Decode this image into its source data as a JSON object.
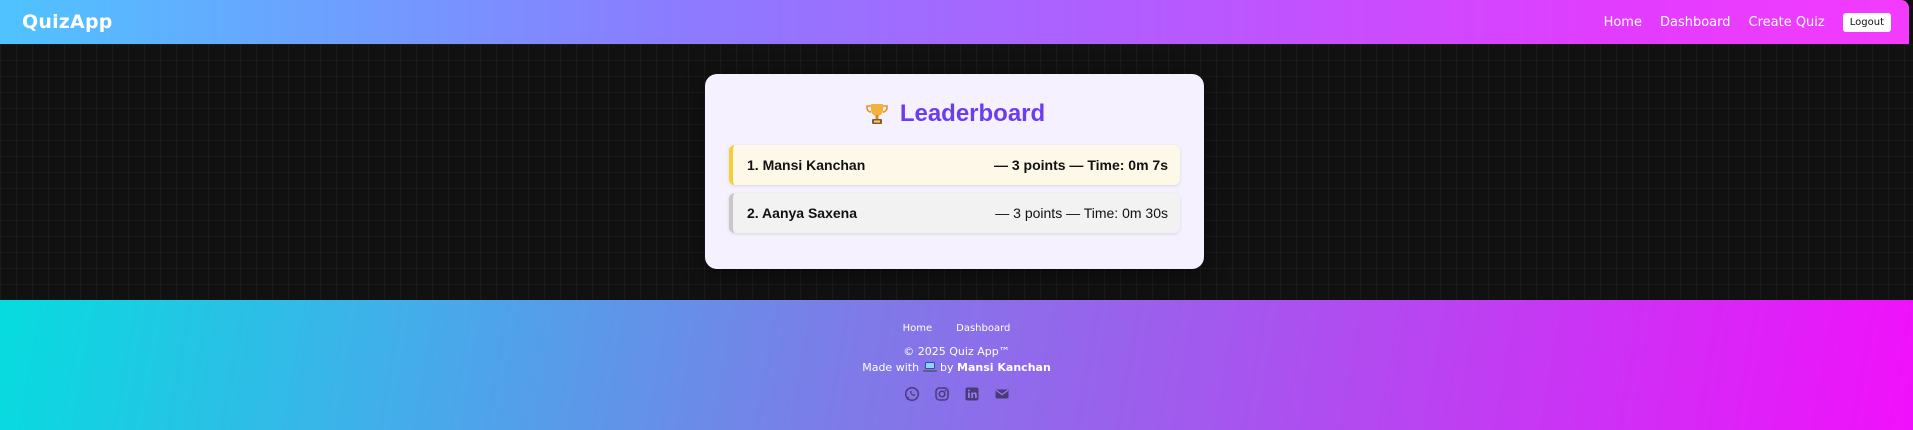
{
  "navbar": {
    "brand": "QuizApp",
    "links": [
      "Home",
      "Dashboard",
      "Create Quiz"
    ],
    "logout_label": "Logout"
  },
  "leaderboard": {
    "icon": "trophy-icon",
    "title": "Leaderboard",
    "entries": [
      {
        "name": "1. Mansi Kanchan",
        "score": "— 3 points — Time: 0m 7s",
        "accent": "#f5cf3b"
      },
      {
        "name": "2. Aanya Saxena",
        "score": "— 3 points — Time: 0m 30s",
        "accent": "#c8c8c8"
      }
    ]
  },
  "footer": {
    "links": [
      "Home",
      "Dashboard"
    ],
    "copyright": "© 2025 Quiz App™",
    "made_with_prefix": "Made with",
    "made_with_icon": "laptop-icon",
    "made_with_by": "by",
    "author": "Mansi Kanchan",
    "socials": [
      "whatsapp-icon",
      "instagram-icon",
      "linkedin-icon",
      "email-icon"
    ]
  },
  "colors": {
    "accent_title": "#6a3ef0",
    "gold": "#f5cf3b",
    "silver": "#c8c8c8"
  }
}
